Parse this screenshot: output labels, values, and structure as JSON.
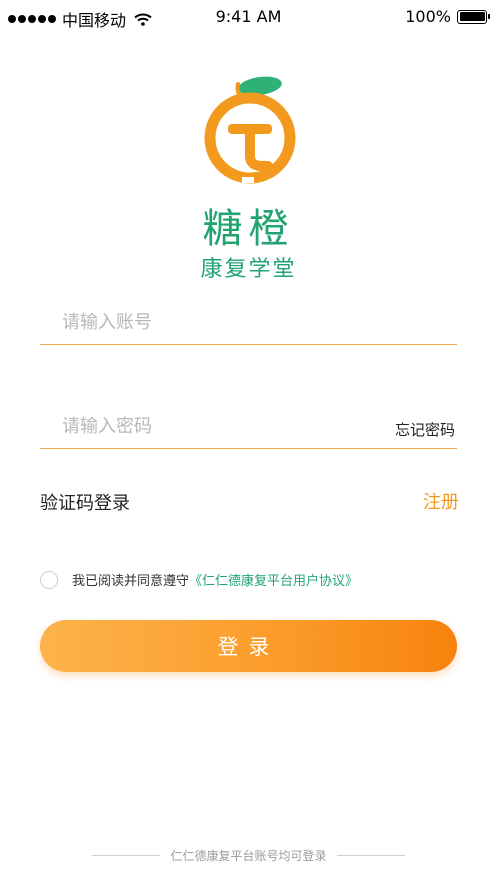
{
  "status_bar": {
    "carrier": "中国移动",
    "time": "9:41 AM",
    "battery": "100%"
  },
  "brand": {
    "title": "糖橙",
    "subtitle": "康复学堂",
    "colors": {
      "green": "#22a372",
      "orange": "#f39a1e"
    }
  },
  "form": {
    "account_placeholder": "请输入账号",
    "password_placeholder": "请输入密码",
    "forgot_password": "忘记密码",
    "sms_login": "验证码登录",
    "register": "注册"
  },
  "agreement": {
    "prefix": "我已阅读并同意遵守",
    "link": "《仁仁德康复平台用户协议》"
  },
  "login_button": "登录",
  "footer": "仁仁德康复平台账号均可登录"
}
